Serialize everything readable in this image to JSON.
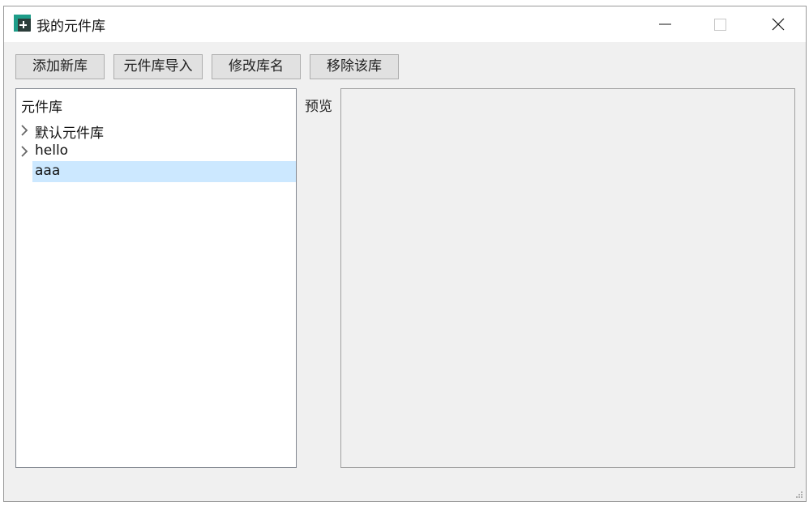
{
  "window": {
    "title": "我的元件库",
    "icon": "app-icon",
    "controls": [
      "minimize-icon",
      "maximize-icon",
      "close-icon"
    ]
  },
  "toolbar": {
    "add_label": "添加新库",
    "import_label": "元件库导入",
    "rename_label": "修改库名",
    "remove_label": "移除该库"
  },
  "tree": {
    "header": "元件库",
    "items": [
      {
        "label": "默认元件库",
        "expandable": true,
        "selected": false
      },
      {
        "label": "hello",
        "expandable": true,
        "selected": false
      },
      {
        "label": "aaa",
        "expandable": false,
        "selected": true
      }
    ]
  },
  "preview": {
    "label": "预览"
  },
  "colors": {
    "selection": "#cce8ff",
    "app_icon_dark": "#2b3d3a",
    "app_icon_accent": "#1e9d89"
  }
}
